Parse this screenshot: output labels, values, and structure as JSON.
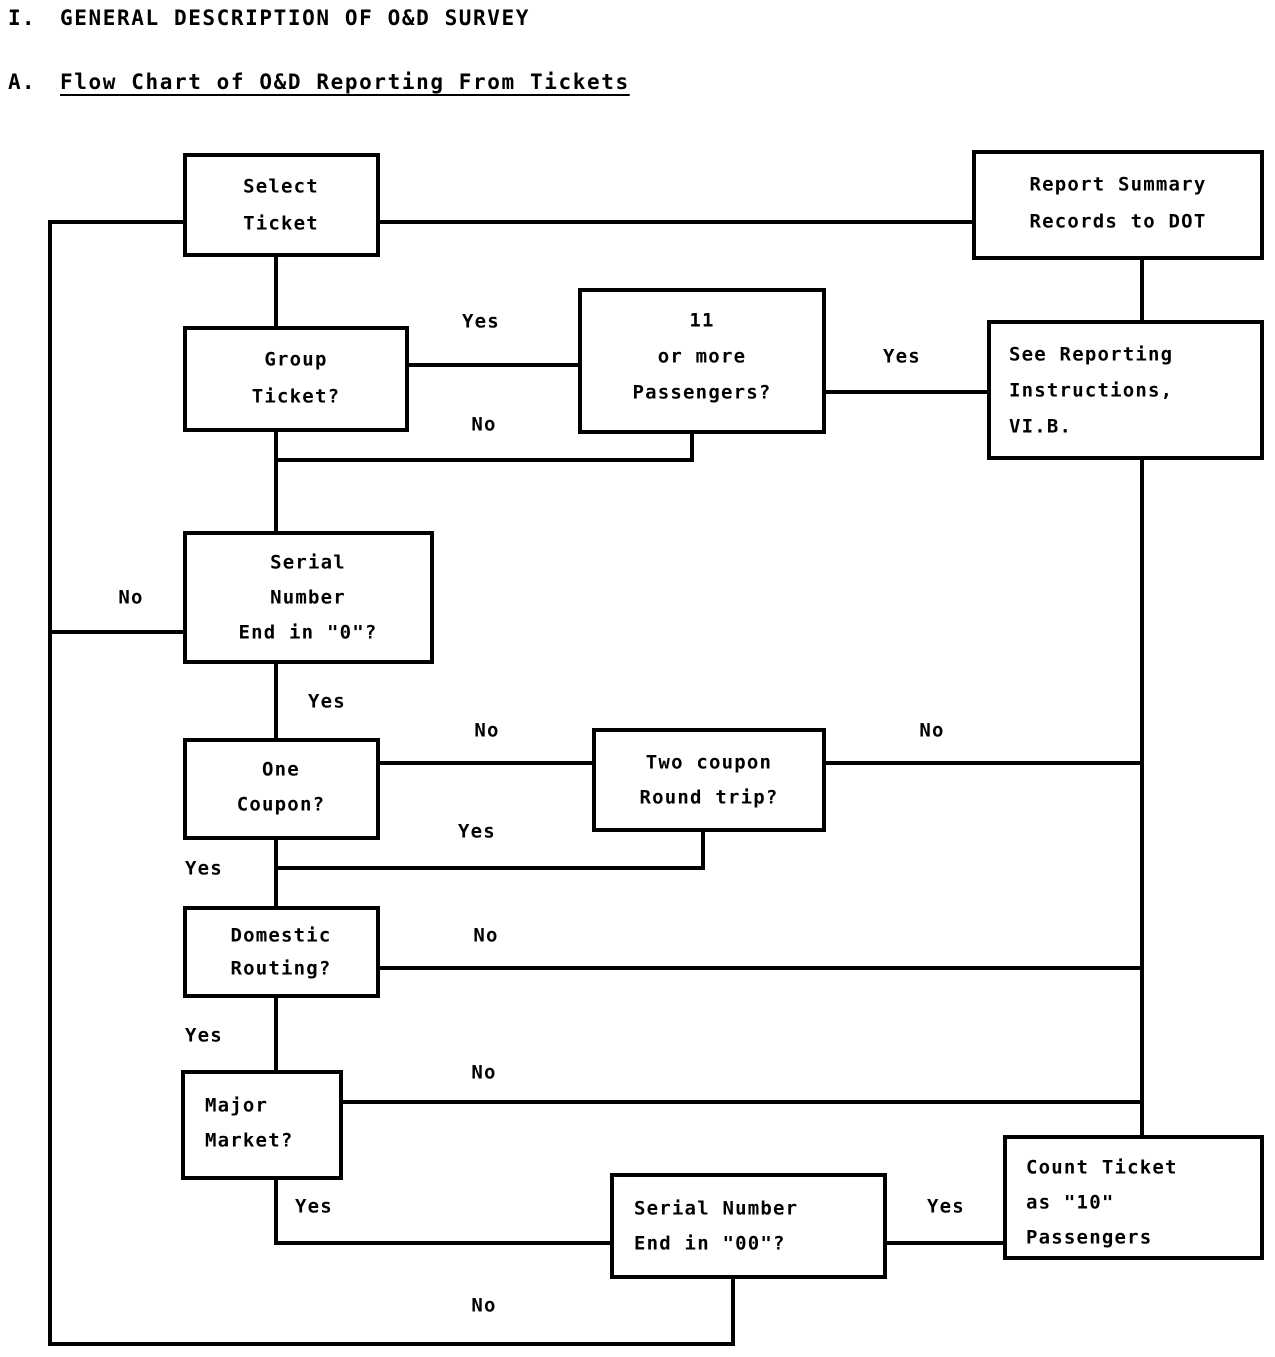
{
  "document": {
    "section_number": "I.",
    "section_title": "GENERAL DESCRIPTION OF O&D SURVEY",
    "subsection_number": "A.",
    "subsection_title": "Flow Chart of O&D Reporting From Tickets"
  },
  "chart_data": {
    "type": "diagram",
    "title": "Flow Chart of O&D Reporting From Tickets",
    "nodes": [
      {
        "id": "select_ticket",
        "lines": [
          "Select",
          "Ticket"
        ],
        "shape": "process"
      },
      {
        "id": "report_summary",
        "lines": [
          "Report Summary",
          "Records to DOT"
        ],
        "shape": "process"
      },
      {
        "id": "group_ticket",
        "lines": [
          "Group",
          "Ticket?"
        ],
        "shape": "decision"
      },
      {
        "id": "eleven_or_more",
        "lines": [
          "11",
          "or more",
          "Passengers?"
        ],
        "shape": "decision"
      },
      {
        "id": "see_reporting",
        "lines": [
          "See Reporting",
          "Instructions,",
          "VI.B."
        ],
        "shape": "process"
      },
      {
        "id": "serial_end_zero",
        "lines": [
          "Serial",
          "Number",
          "End in \"0\"?"
        ],
        "shape": "decision"
      },
      {
        "id": "one_coupon",
        "lines": [
          "One",
          "Coupon?"
        ],
        "shape": "decision"
      },
      {
        "id": "two_coupon",
        "lines": [
          "Two coupon",
          "Round trip?"
        ],
        "shape": "decision"
      },
      {
        "id": "domestic_routing",
        "lines": [
          "Domestic",
          "Routing?"
        ],
        "shape": "decision"
      },
      {
        "id": "major_market",
        "lines": [
          "Major",
          "Market?"
        ],
        "shape": "decision"
      },
      {
        "id": "serial_end_double",
        "lines": [
          "Serial Number",
          "End in \"00\"?"
        ],
        "shape": "decision"
      },
      {
        "id": "count_ticket",
        "lines": [
          "Count Ticket",
          "as \"10\"",
          "Passengers"
        ],
        "shape": "process"
      }
    ],
    "edges": [
      {
        "from": "select_ticket",
        "to": "report_summary",
        "label": ""
      },
      {
        "from": "select_ticket",
        "to": "group_ticket",
        "label": ""
      },
      {
        "from": "group_ticket",
        "to": "eleven_or_more",
        "label": "Yes"
      },
      {
        "from": "group_ticket",
        "to": "serial_end_zero",
        "label": "No"
      },
      {
        "from": "eleven_or_more",
        "to": "see_reporting",
        "label": "Yes"
      },
      {
        "from": "eleven_or_more",
        "to": "serial_end_zero",
        "label": "No"
      },
      {
        "from": "see_reporting",
        "to": "count_ticket",
        "label": ""
      },
      {
        "from": "serial_end_zero",
        "to": "select_ticket",
        "label": "No"
      },
      {
        "from": "serial_end_zero",
        "to": "one_coupon",
        "label": "Yes"
      },
      {
        "from": "one_coupon",
        "to": "two_coupon",
        "label": "No"
      },
      {
        "from": "one_coupon",
        "to": "domestic_routing",
        "label": "Yes"
      },
      {
        "from": "two_coupon",
        "to": "count_ticket",
        "label": "No"
      },
      {
        "from": "two_coupon",
        "to": "domestic_routing",
        "label": "Yes"
      },
      {
        "from": "domestic_routing",
        "to": "count_ticket",
        "label": "No"
      },
      {
        "from": "domestic_routing",
        "to": "major_market",
        "label": "Yes"
      },
      {
        "from": "major_market",
        "to": "count_ticket",
        "label": "No"
      },
      {
        "from": "major_market",
        "to": "serial_end_double",
        "label": "Yes"
      },
      {
        "from": "serial_end_double",
        "to": "count_ticket",
        "label": "Yes"
      },
      {
        "from": "serial_end_double",
        "to": "select_ticket",
        "label": "No"
      }
    ],
    "edge_labels": [
      {
        "id": "group_yes",
        "text": "Yes"
      },
      {
        "id": "group_no",
        "text": "No"
      },
      {
        "id": "eleven_yes",
        "text": "Yes"
      },
      {
        "id": "serial_no",
        "text": "No"
      },
      {
        "id": "serial_yes",
        "text": "Yes"
      },
      {
        "id": "coupon_no",
        "text": "No"
      },
      {
        "id": "twocoupon_no",
        "text": "No"
      },
      {
        "id": "twocoupon_yes",
        "text": "Yes"
      },
      {
        "id": "coupon_yes",
        "text": "Yes"
      },
      {
        "id": "domestic_no",
        "text": "No"
      },
      {
        "id": "domestic_yes",
        "text": "Yes"
      },
      {
        "id": "market_no",
        "text": "No"
      },
      {
        "id": "market_yes",
        "text": "Yes"
      },
      {
        "id": "double_yes",
        "text": "Yes"
      },
      {
        "id": "double_no",
        "text": "No"
      }
    ]
  },
  "colors": {
    "background": "#ffffff",
    "stroke": "#000000",
    "text": "#000000"
  }
}
